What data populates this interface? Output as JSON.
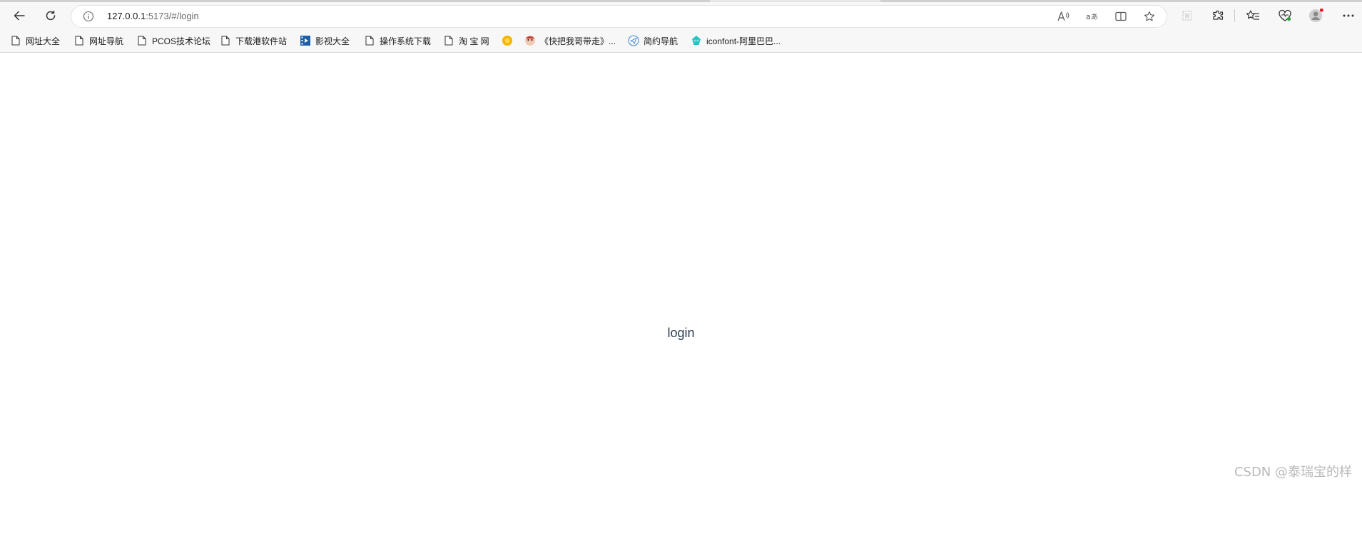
{
  "toolbar": {
    "back_icon": "back-arrow-icon",
    "refresh_icon": "refresh-icon",
    "address_bar": {
      "host": "127.0.0.1",
      "path": ":5173/#/login"
    },
    "address_icons": [
      "read-aloud-icon",
      "translate-icon",
      "split-screen-icon",
      "favorite-star-icon"
    ],
    "right_icons": [
      "screenshot-icon",
      "extensions-icon",
      "favorites-icon",
      "browser-essentials-icon",
      "profile-avatar-icon",
      "more-menu-icon"
    ]
  },
  "bookmarks": [
    {
      "label": "网址大全",
      "icon": "page-icon"
    },
    {
      "label": "网址导航",
      "icon": "page-icon"
    },
    {
      "label": "PCOS技术论坛",
      "icon": "page-icon"
    },
    {
      "label": "下载港软件站",
      "icon": "page-icon"
    },
    {
      "label": "影视大全",
      "icon": "film-icon"
    },
    {
      "label": "操作系统下载",
      "icon": "page-icon"
    },
    {
      "label": "淘 宝 网",
      "icon": "page-icon"
    },
    {
      "label": "",
      "icon": "sun-icon"
    },
    {
      "label": "《快把我哥带走》...",
      "icon": "cartoon-icon"
    },
    {
      "label": "简约导航",
      "icon": "paper-plane-icon"
    },
    {
      "label": "iconfont-阿里巴巴...",
      "icon": "iconfont-icon"
    }
  ],
  "page": {
    "text": "login"
  },
  "watermark": "CSDN @泰瑞宝的样",
  "colors": {
    "chrome_bg": "#f7f7f7",
    "page_text": "#2c3e50",
    "watermark": "#b9b9b9"
  }
}
